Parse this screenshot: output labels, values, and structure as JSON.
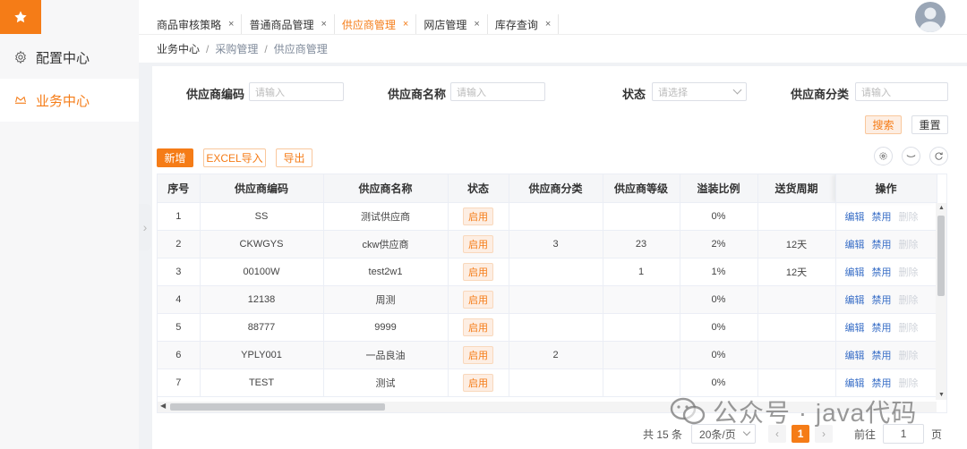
{
  "sidebar": {
    "items": [
      {
        "label": "配置中心",
        "icon": "gear-icon"
      },
      {
        "label": "业务中心",
        "icon": "crown-icon"
      }
    ]
  },
  "tabs": [
    {
      "label": "商品审核策略",
      "close": "×"
    },
    {
      "label": "普通商品管理",
      "close": "×"
    },
    {
      "label": "供应商管理",
      "close": "×"
    },
    {
      "label": "网店管理",
      "close": "×"
    },
    {
      "label": "库存查询",
      "close": "×"
    }
  ],
  "breadcrumb": {
    "root": "业务中心",
    "sep": "/",
    "level2": "采购管理",
    "level3": "供应商管理"
  },
  "filters": {
    "code_label": "供应商编码",
    "code_placeholder": "请输入",
    "name_label": "供应商名称",
    "name_placeholder": "请输入",
    "status_label": "状态",
    "status_placeholder": "请选择",
    "category_label": "供应商分类",
    "category_placeholder": "请输入",
    "search_btn": "搜索",
    "reset_btn": "重置"
  },
  "toolbar": {
    "add": "新增",
    "import": "EXCEL导入",
    "export": "导出"
  },
  "table": {
    "headers": [
      "序号",
      "供应商编码",
      "供应商名称",
      "状态",
      "供应商分类",
      "供应商等级",
      "溢装比例",
      "送货周期",
      "操作"
    ],
    "rows": [
      {
        "no": "1",
        "code": "SS",
        "name": "测试供应商",
        "status": "启用",
        "category": "",
        "grade": "",
        "ratio": "0%",
        "cycle": ""
      },
      {
        "no": "2",
        "code": "CKWGYS",
        "name": "ckw供应商",
        "status": "启用",
        "category": "3",
        "grade": "23",
        "ratio": "2%",
        "cycle": "12天"
      },
      {
        "no": "3",
        "code": "00100W",
        "name": "test2w1",
        "status": "启用",
        "category": "",
        "grade": "1",
        "ratio": "1%",
        "cycle": "12天"
      },
      {
        "no": "4",
        "code": "12138",
        "name": "周测",
        "status": "启用",
        "category": "",
        "grade": "",
        "ratio": "0%",
        "cycle": ""
      },
      {
        "no": "5",
        "code": "88777",
        "name": "9999",
        "status": "启用",
        "category": "",
        "grade": "",
        "ratio": "0%",
        "cycle": ""
      },
      {
        "no": "6",
        "code": "YPLY001",
        "name": "一品良油",
        "status": "启用",
        "category": "2",
        "grade": "",
        "ratio": "0%",
        "cycle": ""
      },
      {
        "no": "7",
        "code": "TEST",
        "name": "测试",
        "status": "启用",
        "category": "",
        "grade": "",
        "ratio": "0%",
        "cycle": ""
      }
    ],
    "ops": {
      "edit": "编辑",
      "disable": "禁用",
      "delete": "删除"
    }
  },
  "pagination": {
    "total": "共 15 条",
    "page_size": "20条/页",
    "current": "1",
    "prev": "‹",
    "next": "›",
    "goto_label": "前往",
    "goto_value": "1",
    "page_unit": "页"
  },
  "watermark": {
    "text": "公众号 · java代码"
  },
  "colors": {
    "accent": "#f57c17",
    "link": "#3a6fc7"
  }
}
